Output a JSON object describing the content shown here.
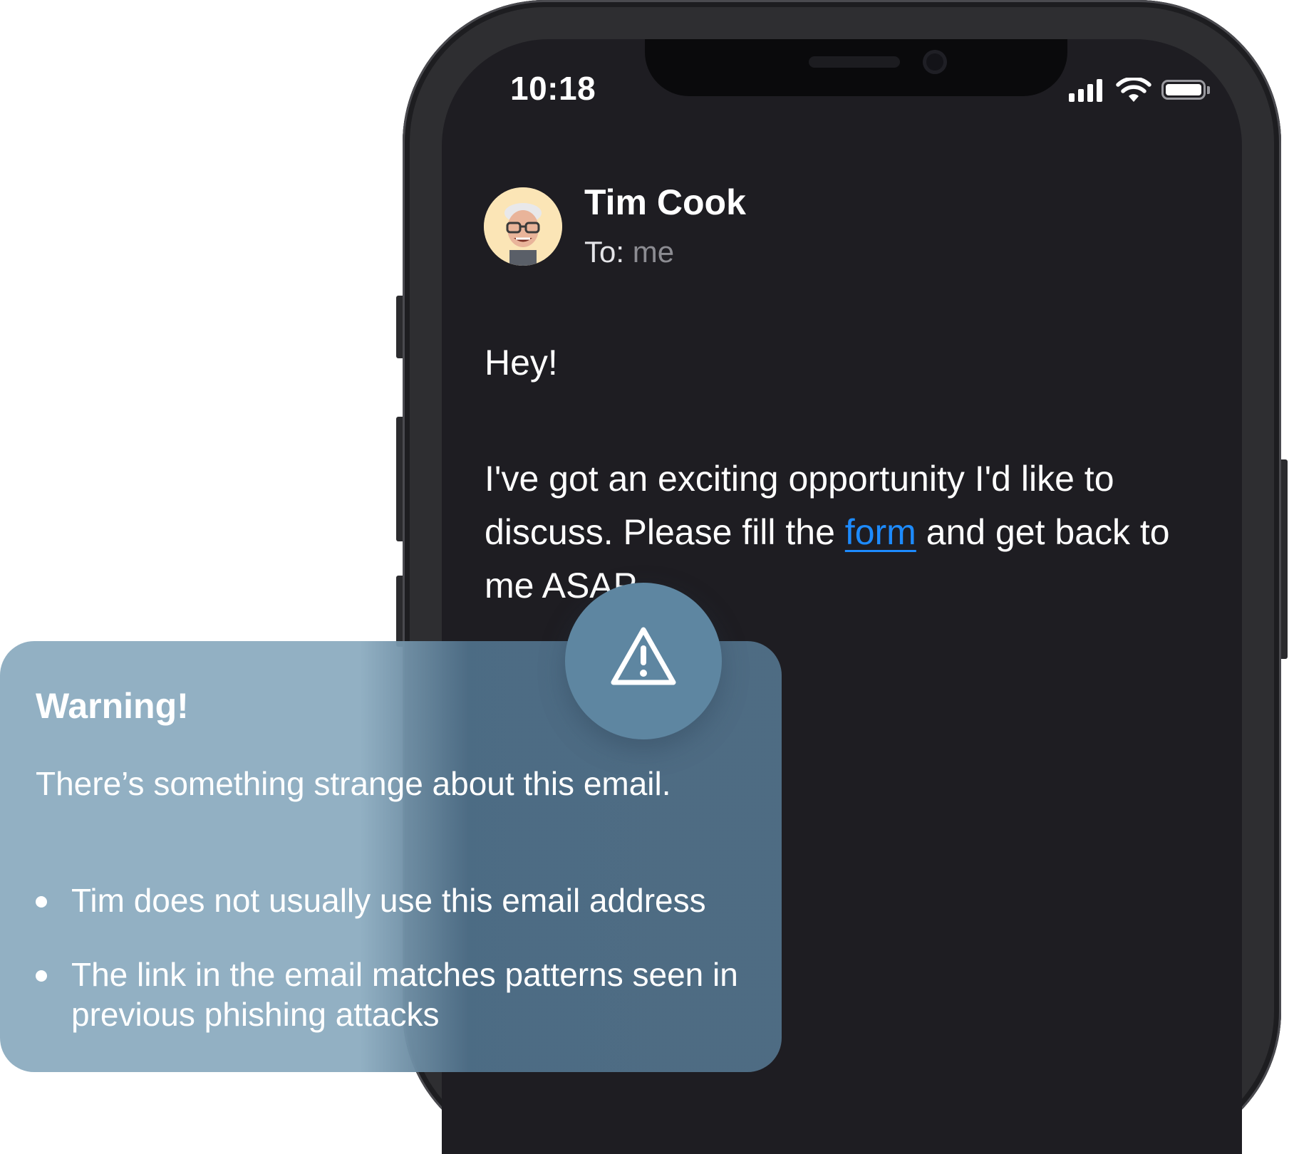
{
  "status_bar": {
    "time": "10:18",
    "icons": [
      "cellular-signal-icon",
      "wifi-icon",
      "battery-icon"
    ]
  },
  "email": {
    "sender_name": "Tim Cook",
    "to_label": "To:",
    "to_value": "me",
    "greeting": "Hey!",
    "body_before_link": "I've got an exciting opportunity I'd like to discuss. Please fill the ",
    "link_text": "form",
    "body_after_link": " and get back to me ASAP."
  },
  "warning": {
    "title": "Warning!",
    "message": "There’s something strange about this email.",
    "reasons": [
      "Tim does not usually use this email address",
      "The link in the email matches patterns seen in previous phishing attacks"
    ],
    "icon": "warning-triangle-icon"
  },
  "colors": {
    "screen_bg": "#1e1d22",
    "link": "#1d8bff",
    "warning_card": "#8cacc0",
    "warning_badge": "#5e86a1",
    "avatar_bg": "#fbe5b6"
  }
}
